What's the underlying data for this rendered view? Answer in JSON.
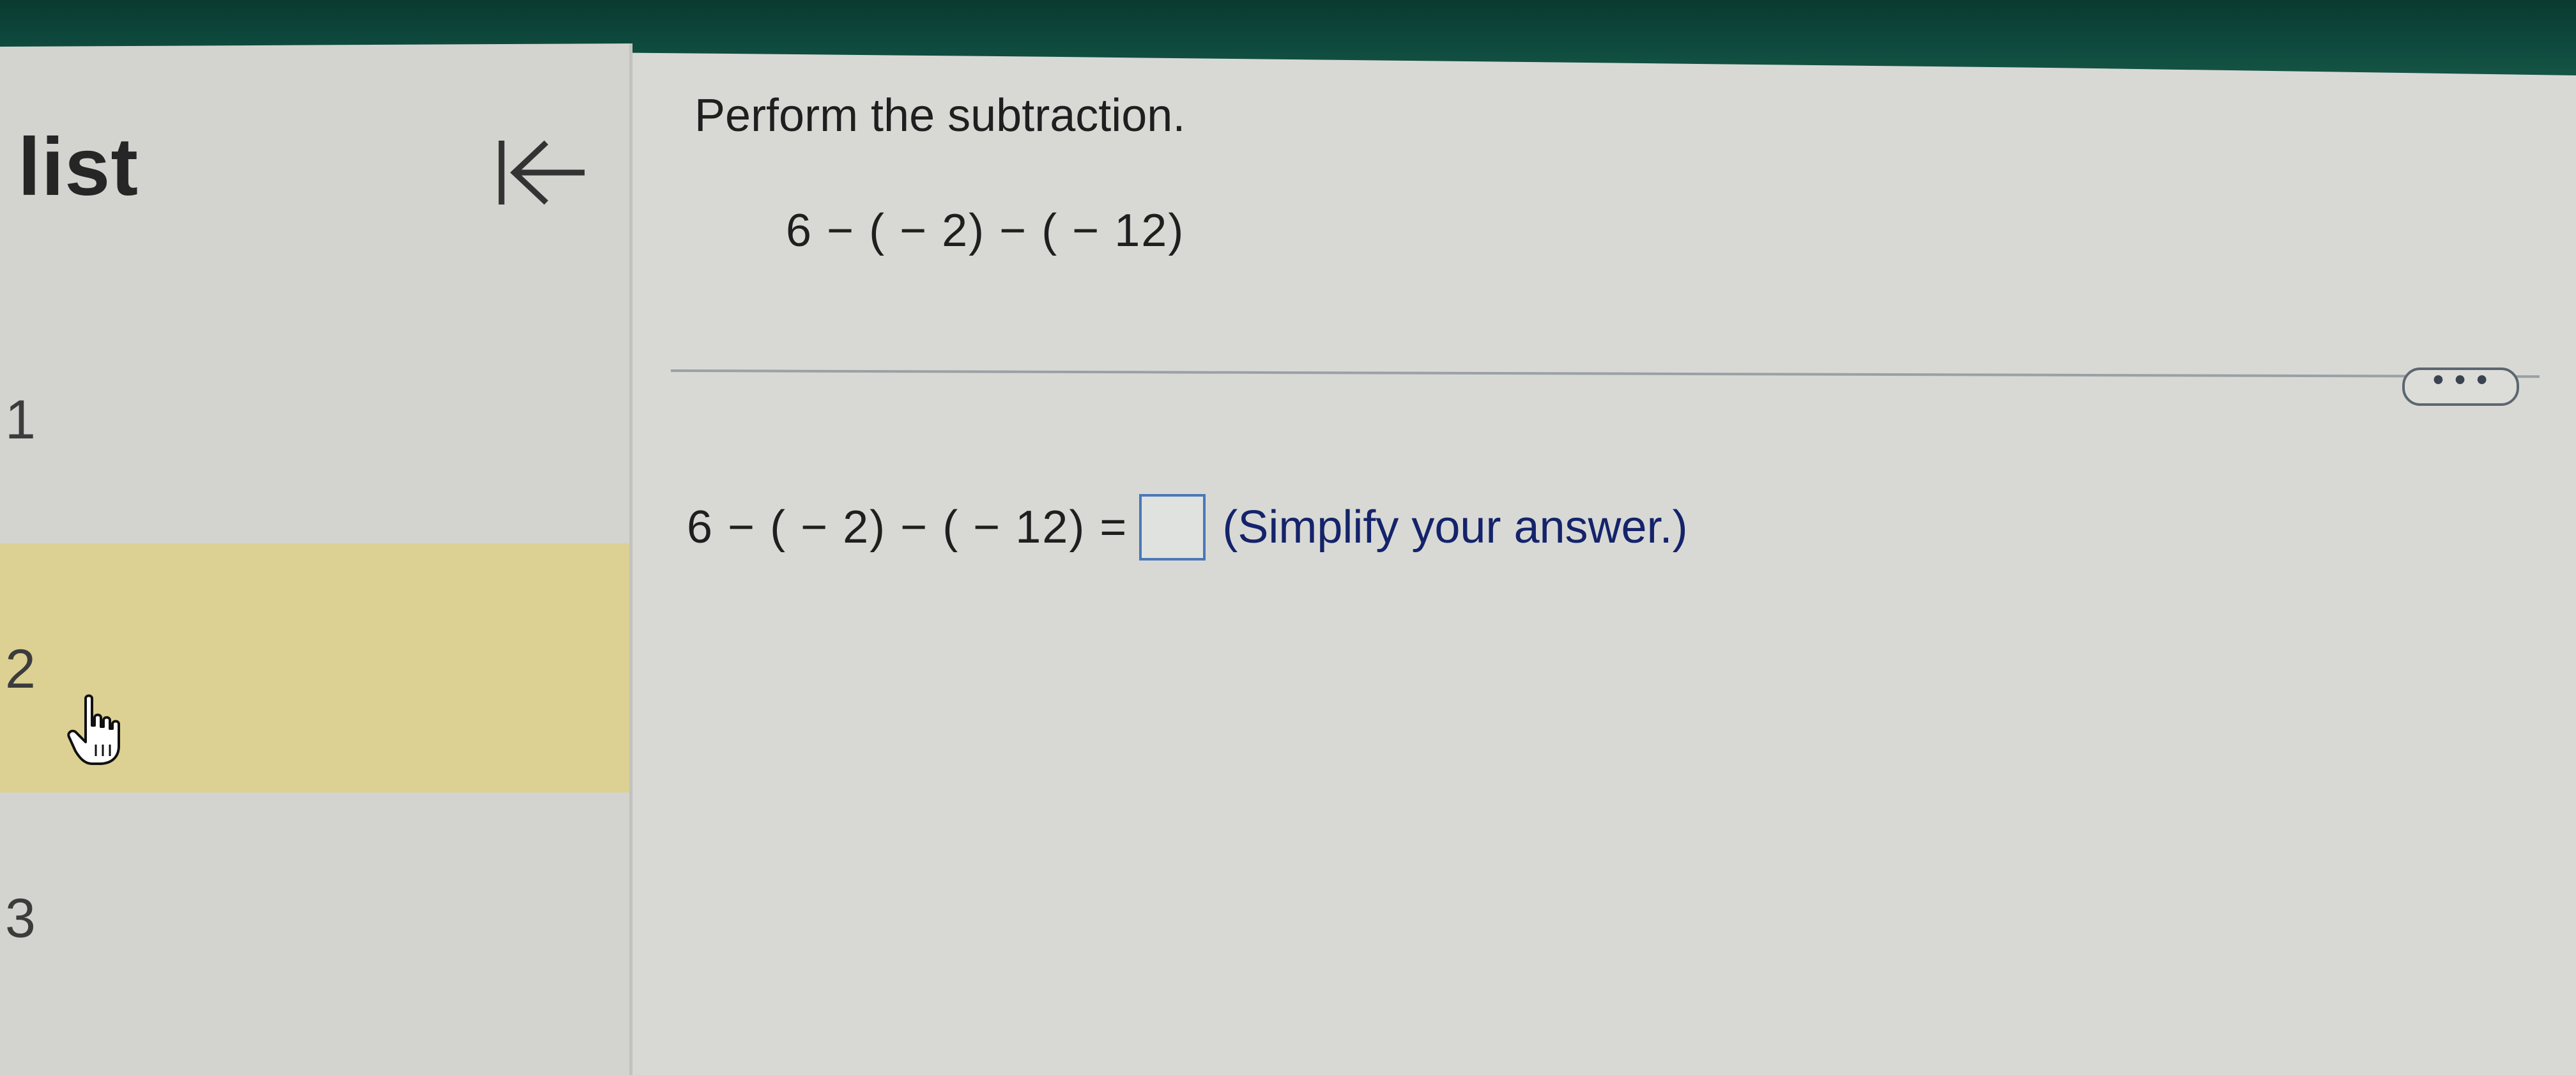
{
  "sidebar": {
    "title": "list",
    "collapse_icon": "collapse-left-icon",
    "items": [
      {
        "label": "1",
        "selected": false
      },
      {
        "label": "2",
        "selected": true
      },
      {
        "label": "3",
        "selected": false
      }
    ]
  },
  "question": {
    "instruction": "Perform the subtraction.",
    "expression": "6 − ( − 2) − ( − 12)",
    "more_options_label": "• • •",
    "answer": {
      "lhs": "6 − ( − 2) − ( − 12) =",
      "value": "",
      "hint": "(Simplify your answer.)"
    }
  },
  "colors": {
    "top_bar": "#0e4a3e",
    "selected_item": "#dcd193",
    "answer_box_border": "#4a78b8",
    "hint_text": "#14236a"
  }
}
